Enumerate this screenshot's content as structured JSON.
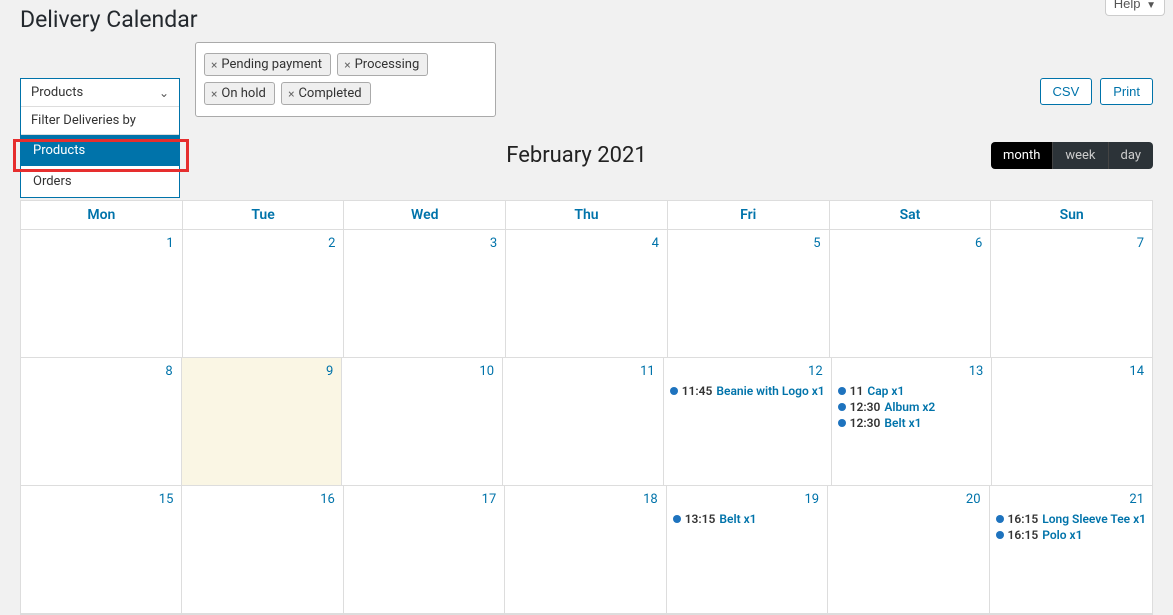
{
  "help_label": "Help",
  "page_title": "Delivery Calendar",
  "filter": {
    "selected": "Products",
    "header": "Filter Deliveries by",
    "options": [
      "Products",
      "Orders"
    ],
    "active_index": 0
  },
  "statuses": [
    "Pending payment",
    "Processing",
    "On hold",
    "Completed"
  ],
  "export": {
    "csv": "CSV",
    "print": "Print"
  },
  "calendar": {
    "title": "February 2021",
    "views": {
      "month": "month",
      "week": "week",
      "day": "day",
      "active": "month"
    },
    "day_headers": [
      "Mon",
      "Tue",
      "Wed",
      "Thu",
      "Fri",
      "Sat",
      "Sun"
    ]
  },
  "weeks": [
    {
      "days": [
        {
          "num": "1",
          "events": []
        },
        {
          "num": "2",
          "events": []
        },
        {
          "num": "3",
          "events": []
        },
        {
          "num": "4",
          "events": []
        },
        {
          "num": "5",
          "events": []
        },
        {
          "num": "6",
          "events": []
        },
        {
          "num": "7",
          "events": []
        }
      ]
    },
    {
      "days": [
        {
          "num": "8",
          "events": []
        },
        {
          "num": "9",
          "today": true,
          "events": []
        },
        {
          "num": "10",
          "events": []
        },
        {
          "num": "11",
          "events": []
        },
        {
          "num": "12",
          "events": [
            {
              "time": "11:45",
              "title": "Beanie with Logo x1",
              "marked": true
            }
          ]
        },
        {
          "num": "13",
          "events": [
            {
              "time": "11",
              "title": "Cap x1",
              "marked": true
            },
            {
              "time": "12:30",
              "title": "Album x2",
              "marked": true
            },
            {
              "time": "12:30",
              "title": "Belt x1",
              "marked": true
            }
          ]
        },
        {
          "num": "14",
          "events": []
        }
      ]
    },
    {
      "days": [
        {
          "num": "15",
          "events": []
        },
        {
          "num": "16",
          "events": []
        },
        {
          "num": "17",
          "events": []
        },
        {
          "num": "18",
          "events": []
        },
        {
          "num": "19",
          "events": [
            {
              "time": "13:15",
              "title": "Belt x1",
              "marked": true
            }
          ]
        },
        {
          "num": "20",
          "events": []
        },
        {
          "num": "21",
          "events": [
            {
              "time": "16:15",
              "title": "Long Sleeve Tee x1",
              "marked": true
            },
            {
              "time": "16:15",
              "title": "Polo x1",
              "marked": false
            }
          ]
        }
      ]
    }
  ]
}
